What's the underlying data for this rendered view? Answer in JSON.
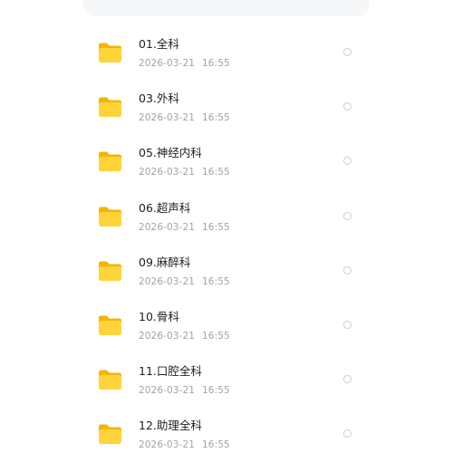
{
  "files": [
    {
      "name": "01.全科",
      "date": "2026-03-21",
      "time": "16:55"
    },
    {
      "name": "03.外科",
      "date": "2026-03-21",
      "time": "16:55"
    },
    {
      "name": "05.神经内科",
      "date": "2026-03-21",
      "time": "16:55"
    },
    {
      "name": "06.超声科",
      "date": "2026-03-21",
      "time": "16:55"
    },
    {
      "name": "09.麻醉科",
      "date": "2026-03-21",
      "time": "16:55"
    },
    {
      "name": "10.骨科",
      "date": "2026-03-21",
      "time": "16:55"
    },
    {
      "name": "11.口腔全科",
      "date": "2026-03-21",
      "time": "16:55"
    },
    {
      "name": "12.助理全科",
      "date": "2026-03-21",
      "time": "16:55"
    }
  ],
  "icons": {
    "folder": "folder-icon",
    "select": "radio-circle"
  },
  "colors": {
    "folder_body": "#ffd43b",
    "folder_tab": "#f4b400",
    "name_text": "#1f1f1f",
    "meta_text": "#a3a3a3",
    "radio_border": "#cfcfcf"
  }
}
